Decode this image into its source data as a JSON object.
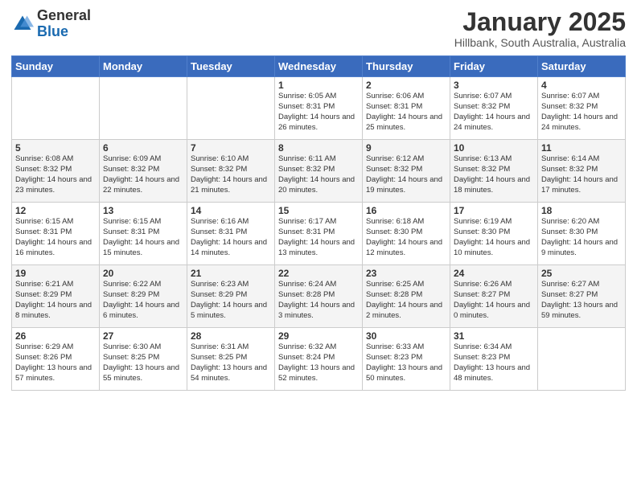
{
  "logo": {
    "general": "General",
    "blue": "Blue"
  },
  "header": {
    "month": "January 2025",
    "location": "Hillbank, South Australia, Australia"
  },
  "days_of_week": [
    "Sunday",
    "Monday",
    "Tuesday",
    "Wednesday",
    "Thursday",
    "Friday",
    "Saturday"
  ],
  "weeks": [
    [
      {
        "day": "",
        "info": ""
      },
      {
        "day": "",
        "info": ""
      },
      {
        "day": "",
        "info": ""
      },
      {
        "day": "1",
        "info": "Sunrise: 6:05 AM\nSunset: 8:31 PM\nDaylight: 14 hours and 26 minutes."
      },
      {
        "day": "2",
        "info": "Sunrise: 6:06 AM\nSunset: 8:31 PM\nDaylight: 14 hours and 25 minutes."
      },
      {
        "day": "3",
        "info": "Sunrise: 6:07 AM\nSunset: 8:32 PM\nDaylight: 14 hours and 24 minutes."
      },
      {
        "day": "4",
        "info": "Sunrise: 6:07 AM\nSunset: 8:32 PM\nDaylight: 14 hours and 24 minutes."
      }
    ],
    [
      {
        "day": "5",
        "info": "Sunrise: 6:08 AM\nSunset: 8:32 PM\nDaylight: 14 hours and 23 minutes."
      },
      {
        "day": "6",
        "info": "Sunrise: 6:09 AM\nSunset: 8:32 PM\nDaylight: 14 hours and 22 minutes."
      },
      {
        "day": "7",
        "info": "Sunrise: 6:10 AM\nSunset: 8:32 PM\nDaylight: 14 hours and 21 minutes."
      },
      {
        "day": "8",
        "info": "Sunrise: 6:11 AM\nSunset: 8:32 PM\nDaylight: 14 hours and 20 minutes."
      },
      {
        "day": "9",
        "info": "Sunrise: 6:12 AM\nSunset: 8:32 PM\nDaylight: 14 hours and 19 minutes."
      },
      {
        "day": "10",
        "info": "Sunrise: 6:13 AM\nSunset: 8:32 PM\nDaylight: 14 hours and 18 minutes."
      },
      {
        "day": "11",
        "info": "Sunrise: 6:14 AM\nSunset: 8:32 PM\nDaylight: 14 hours and 17 minutes."
      }
    ],
    [
      {
        "day": "12",
        "info": "Sunrise: 6:15 AM\nSunset: 8:31 PM\nDaylight: 14 hours and 16 minutes."
      },
      {
        "day": "13",
        "info": "Sunrise: 6:15 AM\nSunset: 8:31 PM\nDaylight: 14 hours and 15 minutes."
      },
      {
        "day": "14",
        "info": "Sunrise: 6:16 AM\nSunset: 8:31 PM\nDaylight: 14 hours and 14 minutes."
      },
      {
        "day": "15",
        "info": "Sunrise: 6:17 AM\nSunset: 8:31 PM\nDaylight: 14 hours and 13 minutes."
      },
      {
        "day": "16",
        "info": "Sunrise: 6:18 AM\nSunset: 8:30 PM\nDaylight: 14 hours and 12 minutes."
      },
      {
        "day": "17",
        "info": "Sunrise: 6:19 AM\nSunset: 8:30 PM\nDaylight: 14 hours and 10 minutes."
      },
      {
        "day": "18",
        "info": "Sunrise: 6:20 AM\nSunset: 8:30 PM\nDaylight: 14 hours and 9 minutes."
      }
    ],
    [
      {
        "day": "19",
        "info": "Sunrise: 6:21 AM\nSunset: 8:29 PM\nDaylight: 14 hours and 8 minutes."
      },
      {
        "day": "20",
        "info": "Sunrise: 6:22 AM\nSunset: 8:29 PM\nDaylight: 14 hours and 6 minutes."
      },
      {
        "day": "21",
        "info": "Sunrise: 6:23 AM\nSunset: 8:29 PM\nDaylight: 14 hours and 5 minutes."
      },
      {
        "day": "22",
        "info": "Sunrise: 6:24 AM\nSunset: 8:28 PM\nDaylight: 14 hours and 3 minutes."
      },
      {
        "day": "23",
        "info": "Sunrise: 6:25 AM\nSunset: 8:28 PM\nDaylight: 14 hours and 2 minutes."
      },
      {
        "day": "24",
        "info": "Sunrise: 6:26 AM\nSunset: 8:27 PM\nDaylight: 14 hours and 0 minutes."
      },
      {
        "day": "25",
        "info": "Sunrise: 6:27 AM\nSunset: 8:27 PM\nDaylight: 13 hours and 59 minutes."
      }
    ],
    [
      {
        "day": "26",
        "info": "Sunrise: 6:29 AM\nSunset: 8:26 PM\nDaylight: 13 hours and 57 minutes."
      },
      {
        "day": "27",
        "info": "Sunrise: 6:30 AM\nSunset: 8:25 PM\nDaylight: 13 hours and 55 minutes."
      },
      {
        "day": "28",
        "info": "Sunrise: 6:31 AM\nSunset: 8:25 PM\nDaylight: 13 hours and 54 minutes."
      },
      {
        "day": "29",
        "info": "Sunrise: 6:32 AM\nSunset: 8:24 PM\nDaylight: 13 hours and 52 minutes."
      },
      {
        "day": "30",
        "info": "Sunrise: 6:33 AM\nSunset: 8:23 PM\nDaylight: 13 hours and 50 minutes."
      },
      {
        "day": "31",
        "info": "Sunrise: 6:34 AM\nSunset: 8:23 PM\nDaylight: 13 hours and 48 minutes."
      },
      {
        "day": "",
        "info": ""
      }
    ]
  ]
}
